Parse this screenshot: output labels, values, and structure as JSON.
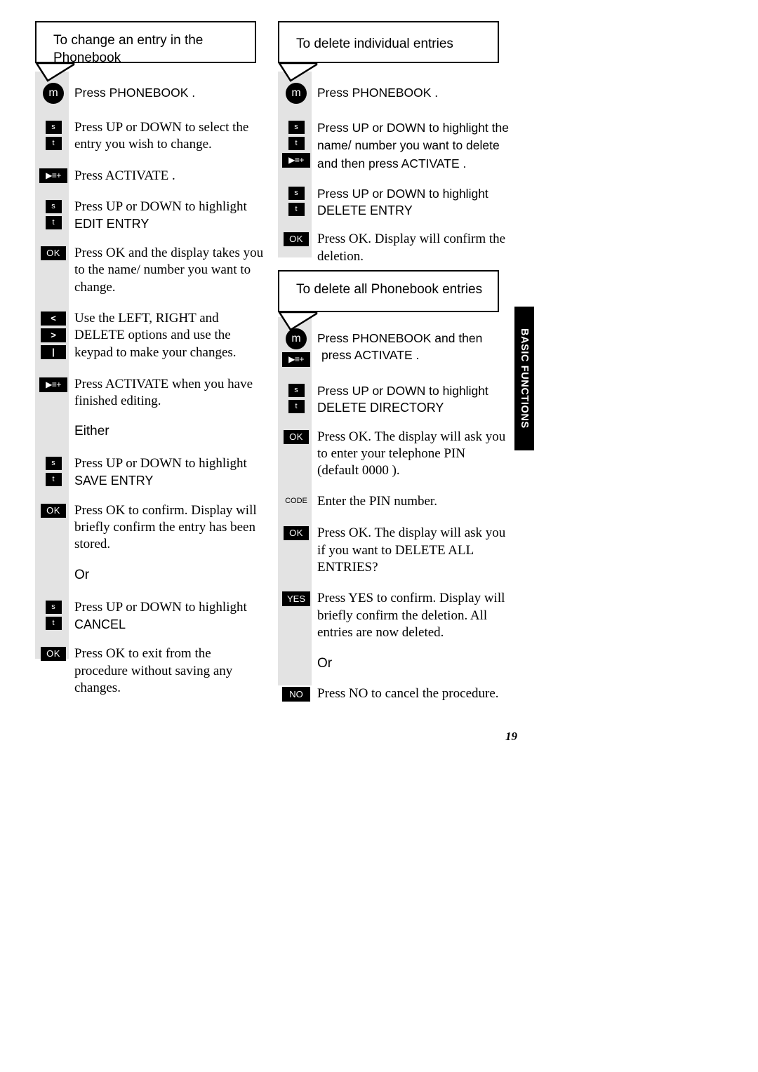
{
  "page": {
    "number": "19",
    "side_tab": "BASIC FUNCTIONS"
  },
  "sections": [
    {
      "id": "change-entry",
      "heading": "To change an entry in the Phonebook",
      "steps": [
        {
          "keys": [
            "phonebook"
          ],
          "text": "Press PHONEBOOK ."
        },
        {
          "keys": [
            "up",
            "down"
          ],
          "text": "Press UP or DOWN to select the entry you wish to change."
        },
        {
          "keys": [
            "activate"
          ],
          "text": "Press ACTIVATE ."
        },
        {
          "keys": [
            "up",
            "down"
          ],
          "text": "Press UP or DOWN to highlight EDIT ENTRY"
        },
        {
          "keys": [
            "ok"
          ],
          "text": "Press OK and the display takes you to the name/ number you want to change."
        },
        {
          "keys": [
            "left",
            "right",
            "delete"
          ],
          "text": "Use the LEFT, RIGHT and DELETE options and use the keypad to make your changes."
        },
        {
          "keys": [
            "activate"
          ],
          "text": "Press ACTIVATE when you have finished editing."
        },
        {
          "keys": [],
          "text": "Either"
        },
        {
          "keys": [
            "up",
            "down"
          ],
          "text": "Press UP or DOWN to highlight SAVE ENTRY"
        },
        {
          "keys": [
            "ok"
          ],
          "text": "Press OK to confirm. Display will briefly confirm the entry has been stored."
        },
        {
          "keys": [],
          "text": "Or"
        },
        {
          "keys": [
            "up",
            "down"
          ],
          "text": "Press UP or DOWN to highlight CANCEL"
        },
        {
          "keys": [
            "ok"
          ],
          "text": "Press OK to exit from the procedure without saving any changes."
        }
      ]
    },
    {
      "id": "delete-individual",
      "heading": "To delete individual entries",
      "steps": [
        {
          "keys": [
            "phonebook"
          ],
          "text": "Press PHONEBOOK ."
        },
        {
          "keys": [
            "up",
            "down",
            "activate"
          ],
          "text": "Press UP or DOWN to highlight the name/ number you want to delete and then press ACTIVATE ."
        },
        {
          "keys": [
            "up",
            "down"
          ],
          "text": "Press UP or DOWN to highlight DELETE ENTRY"
        },
        {
          "keys": [
            "ok"
          ],
          "text": "Press OK. Display will confirm the deletion."
        }
      ]
    },
    {
      "id": "delete-all",
      "heading": "To delete all Phonebook entries",
      "steps": [
        {
          "keys": [
            "phonebook",
            "activate"
          ],
          "text": "Press PHONEBOOK and then press ACTIVATE ."
        },
        {
          "keys": [
            "up",
            "down"
          ],
          "text": "Press UP or DOWN to highlight DELETE DIRECTORY"
        },
        {
          "keys": [
            "ok"
          ],
          "text": "Press OK. The display will ask you to enter your telephone PIN (default 0000 )."
        },
        {
          "keys": [
            "code"
          ],
          "text": "Enter the PIN number."
        },
        {
          "keys": [
            "ok"
          ],
          "text": "Press OK. The display will ask you if you want to DELETE ALL ENTRIES?"
        },
        {
          "keys": [
            "yes"
          ],
          "text": "Press YES to confirm. Display will briefly confirm the deletion. All entries are now deleted."
        },
        {
          "keys": [],
          "text": "Or"
        },
        {
          "keys": [
            "no"
          ],
          "text": "Press NO to cancel the procedure."
        }
      ]
    }
  ],
  "labels": {
    "either": "Either",
    "or": "Or",
    "edit_entry": "EDIT ENTRY",
    "save_entry": "SAVE ENTRY",
    "cancel": "CANCEL",
    "delete_entry": "DELETE ENTRY",
    "delete_directory": "DELETE DIRECTORY",
    "press_phonebook": "Press PHONEBOOK .",
    "press_activate": "Press ACTIVATE .",
    "heading1": "To change an entry in the Phonebook",
    "heading2": "To delete individual entries",
    "heading3": "To delete all Phonebook entries"
  },
  "keys": {
    "ok": "OK",
    "yes": "YES",
    "no": "NO",
    "code": "CODE",
    "up": "s",
    "down": "t",
    "left": "<",
    "right": ">",
    "delete": "|",
    "phonebook": "m",
    "activate": "▶≡+"
  }
}
